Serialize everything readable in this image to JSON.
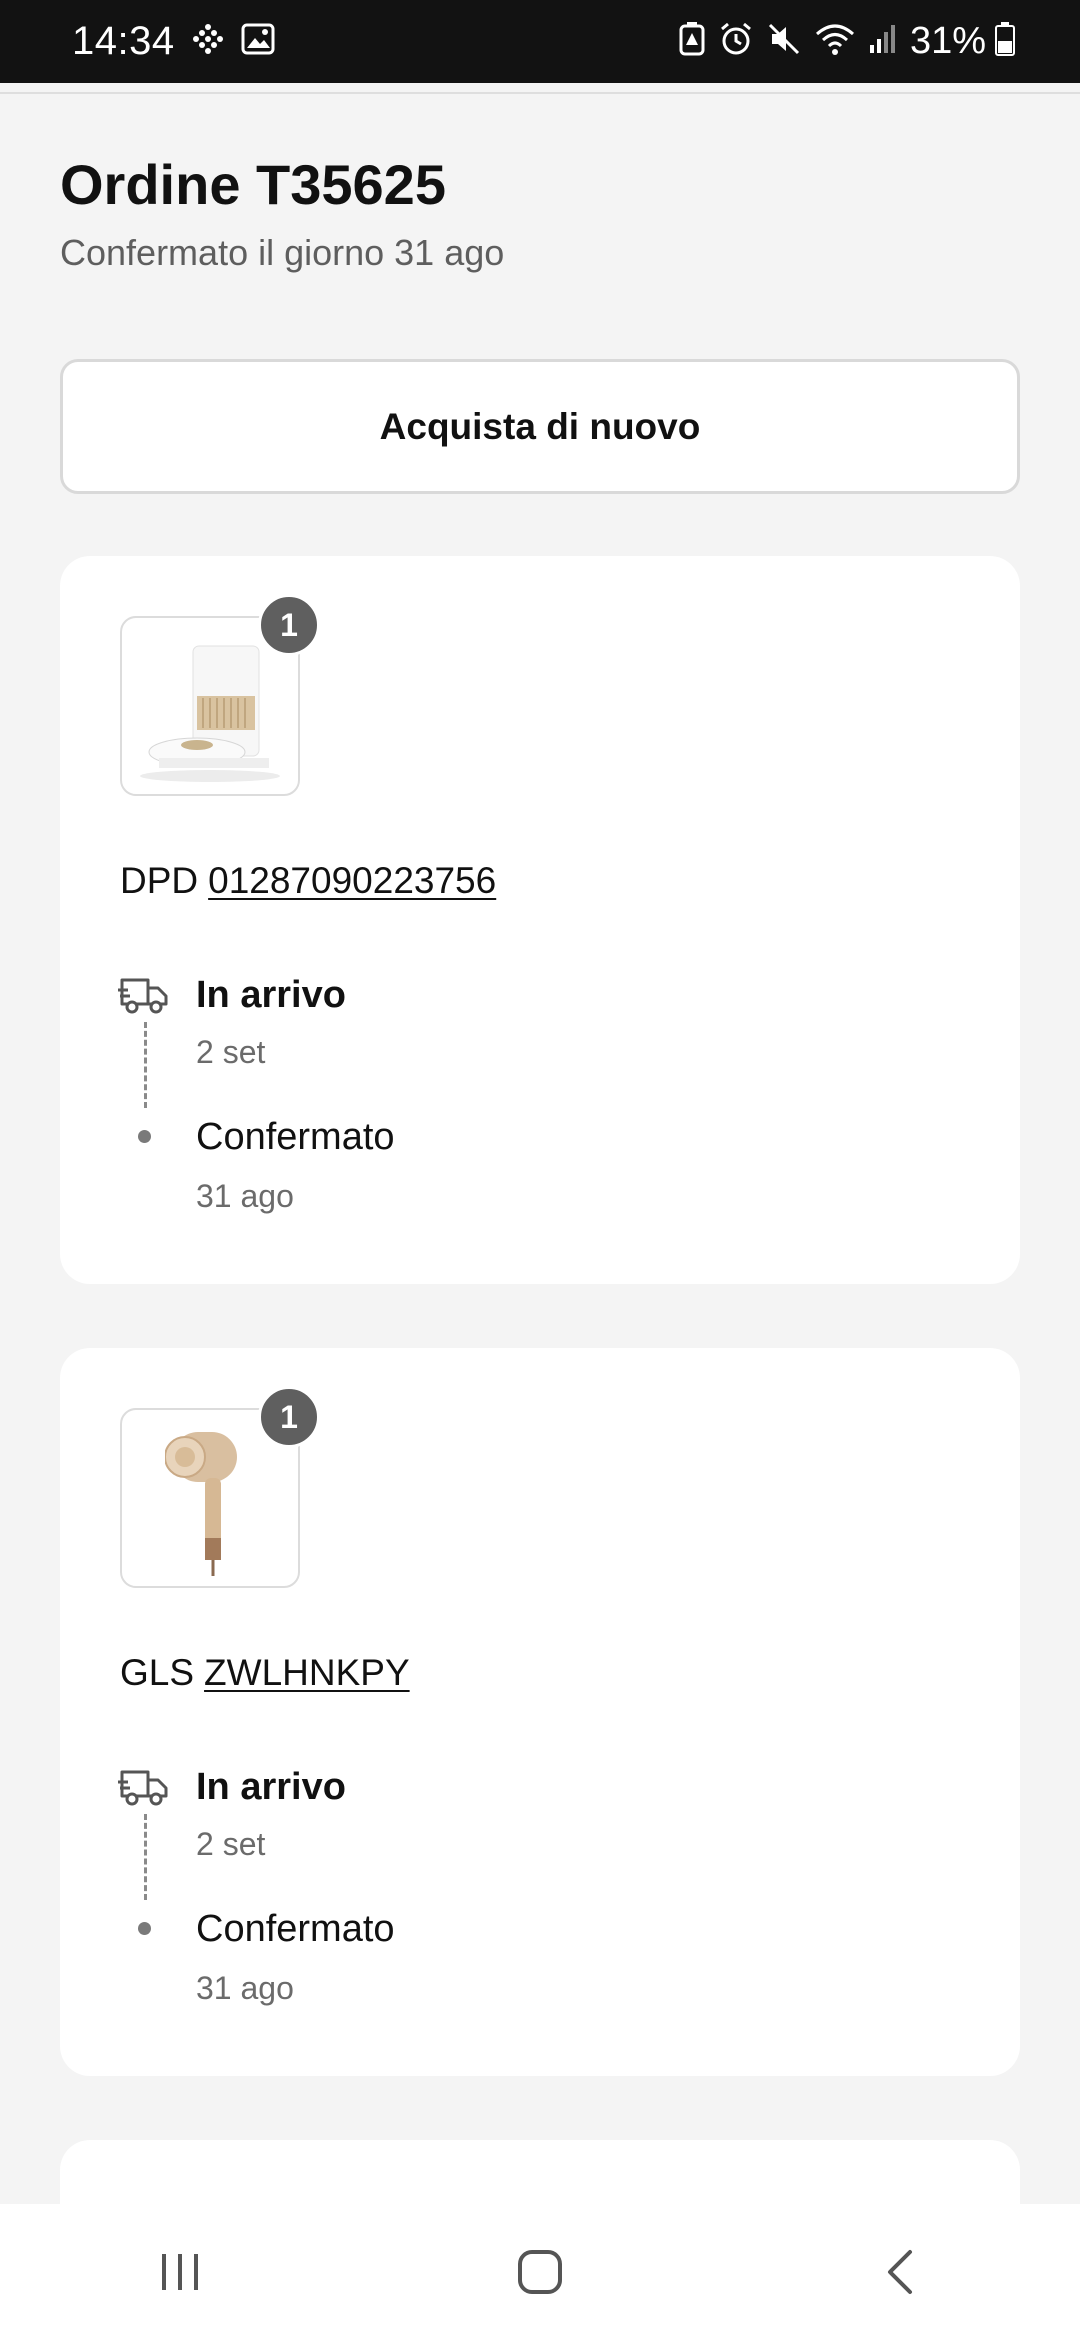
{
  "status_bar": {
    "time": "14:34",
    "battery": "31%",
    "icons": [
      "grid-dots-icon",
      "image-icon",
      "battery-saver-icon",
      "alarm-icon",
      "mute-icon",
      "wifi-icon",
      "signal-icon",
      "battery-icon"
    ]
  },
  "header": {
    "title": "Ordine T35625",
    "subtitle": "Confermato il giorno 31 ago"
  },
  "actions": {
    "buy_again": "Acquista di nuovo"
  },
  "shipments": [
    {
      "quantity": "1",
      "product_image": "robot-vacuum-station",
      "carrier": "DPD",
      "tracking_code": "01287090223756",
      "steps": [
        {
          "title": "In arrivo",
          "date": "2 set",
          "icon": "delivery-truck-icon"
        },
        {
          "title": "Confermato",
          "date": "31 ago",
          "icon": "dot"
        }
      ]
    },
    {
      "quantity": "1",
      "product_image": "hair-dryer",
      "carrier": "GLS",
      "tracking_code": "ZWLHNKPY",
      "steps": [
        {
          "title": "In arrivo",
          "date": "2 set",
          "icon": "delivery-truck-icon"
        },
        {
          "title": "Confermato",
          "date": "31 ago",
          "icon": "dot"
        }
      ]
    }
  ],
  "colors": {
    "background": "#f4f4f4",
    "card": "#ffffff",
    "badge": "#5f5f5f",
    "status_bar": "#121212"
  }
}
